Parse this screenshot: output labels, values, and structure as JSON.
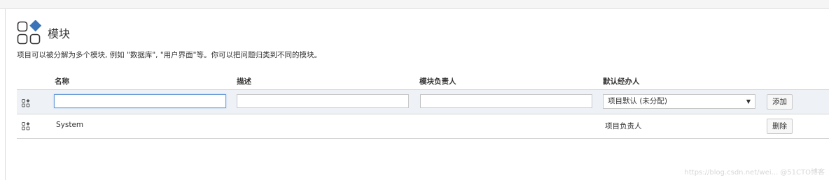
{
  "header": {
    "title": "模块",
    "icon": "modules-icon"
  },
  "description": "项目可以被分解为多个模块, 例如 \"数据库\", \"用户界面\"等。你可以把问题归类到不同的模块。",
  "table": {
    "columns": [
      "名称",
      "描述",
      "模块负责人",
      "默认经办人"
    ],
    "add_row": {
      "name_value": "",
      "description_value": "",
      "lead_value": "",
      "assignee_selected": "项目默认 (未分配)",
      "add_label": "添加"
    },
    "rows": [
      {
        "name": "System",
        "description": "",
        "lead": "",
        "assignee": "项目负责人",
        "delete_label": "删除"
      }
    ]
  },
  "watermark": "https://blog.csdn.net/wei... @51CTO博客",
  "colors": {
    "accent": "#3b73b9",
    "focus_border": "#6a9bd8",
    "add_row_bg": "#eef2f7"
  }
}
